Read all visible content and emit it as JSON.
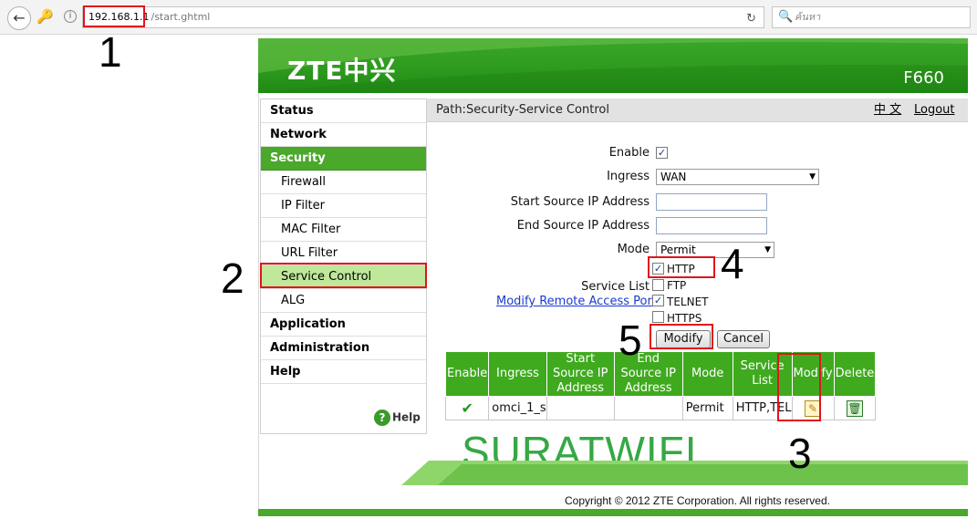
{
  "browser": {
    "url_host": "192.168.1.1",
    "url_path": "/start.ghtml",
    "search_placeholder": "ค้นหา"
  },
  "header": {
    "logo_text": "ZTE中兴",
    "model": "F660"
  },
  "sidebar": {
    "items": [
      {
        "label": "Status"
      },
      {
        "label": "Network"
      },
      {
        "label": "Security"
      },
      {
        "label": "Firewall"
      },
      {
        "label": "IP Filter"
      },
      {
        "label": "MAC Filter"
      },
      {
        "label": "URL Filter"
      },
      {
        "label": "Service Control"
      },
      {
        "label": "ALG"
      },
      {
        "label": "Application"
      },
      {
        "label": "Administration"
      },
      {
        "label": "Help"
      }
    ],
    "help_label": "Help"
  },
  "path_bar": {
    "path": "Path:Security-Service Control",
    "lang": "中 文",
    "logout": "Logout"
  },
  "form": {
    "enable_label": "Enable",
    "enable_checked": true,
    "ingress_label": "Ingress",
    "ingress_value": "WAN",
    "start_ip_label": "Start Source IP Address",
    "start_ip_value": "",
    "end_ip_label": "End Source IP Address",
    "end_ip_value": "",
    "mode_label": "Mode",
    "mode_value": "Permit",
    "service_list_label": "Service List",
    "services": [
      {
        "label": "HTTP",
        "checked": true
      },
      {
        "label": "FTP",
        "checked": false
      },
      {
        "label": "TELNET",
        "checked": true
      },
      {
        "label": "HTTPS",
        "checked": false
      }
    ],
    "remote_link": "Modify Remote Access Port",
    "modify_button": "Modify",
    "cancel_button": "Cancel"
  },
  "table": {
    "headers": [
      "Enable",
      "Ingress",
      "Start Source IP Address",
      "End Source IP Address",
      "Mode",
      "Service List",
      "Modify",
      "Delete"
    ],
    "rows": [
      {
        "ingress": "omci_1_s",
        "start_ip": "",
        "end_ip": "",
        "mode": "Permit",
        "services": "HTTP,TEL"
      }
    ]
  },
  "annotations": {
    "steps": [
      "1",
      "2",
      "3",
      "4",
      "5"
    ],
    "watermark": "SURATWIFI"
  },
  "footer": {
    "copyright": "Copyright © 2012 ZTE Corporation. All rights reserved."
  },
  "colors": {
    "brand_green": "#3faa1e",
    "highlight_red": "#e0141e",
    "link_blue": "#1a3ad0"
  }
}
